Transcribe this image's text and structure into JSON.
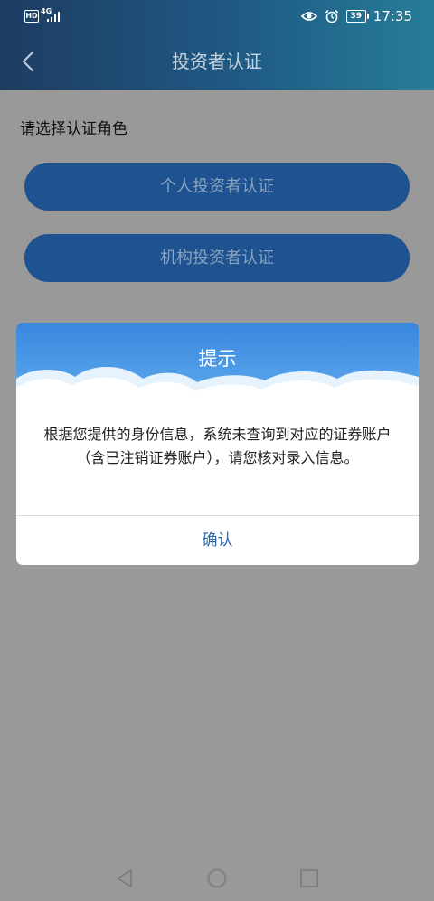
{
  "status_bar": {
    "hd_label": "HD",
    "network_label": "4G",
    "battery_level": "39",
    "time": "17:35",
    "icons": [
      "eye-icon",
      "alarm-icon"
    ]
  },
  "header": {
    "title": "投资者认证",
    "back_icon": "chevron-left-icon"
  },
  "main": {
    "section_label": "请选择认证角色",
    "buttons": [
      {
        "label": "个人投资者认证"
      },
      {
        "label": "机构投资者认证"
      }
    ]
  },
  "dialog": {
    "title": "提示",
    "message": "根据您提供的身份信息，系统未查询到对应的证券账户（含已注销证券账户），请您核对录入信息。",
    "confirm_label": "确认"
  },
  "nav_bar": {
    "icons": [
      "triangle-back-icon",
      "circle-home-icon",
      "square-recent-icon"
    ]
  },
  "colors": {
    "overlay": "#999999",
    "header_start": "#1e3c62",
    "header_end": "#277d97",
    "button_bg": "#1f5290",
    "dialog_sky": "#3b8de0",
    "confirm_text": "#2b66a8"
  }
}
